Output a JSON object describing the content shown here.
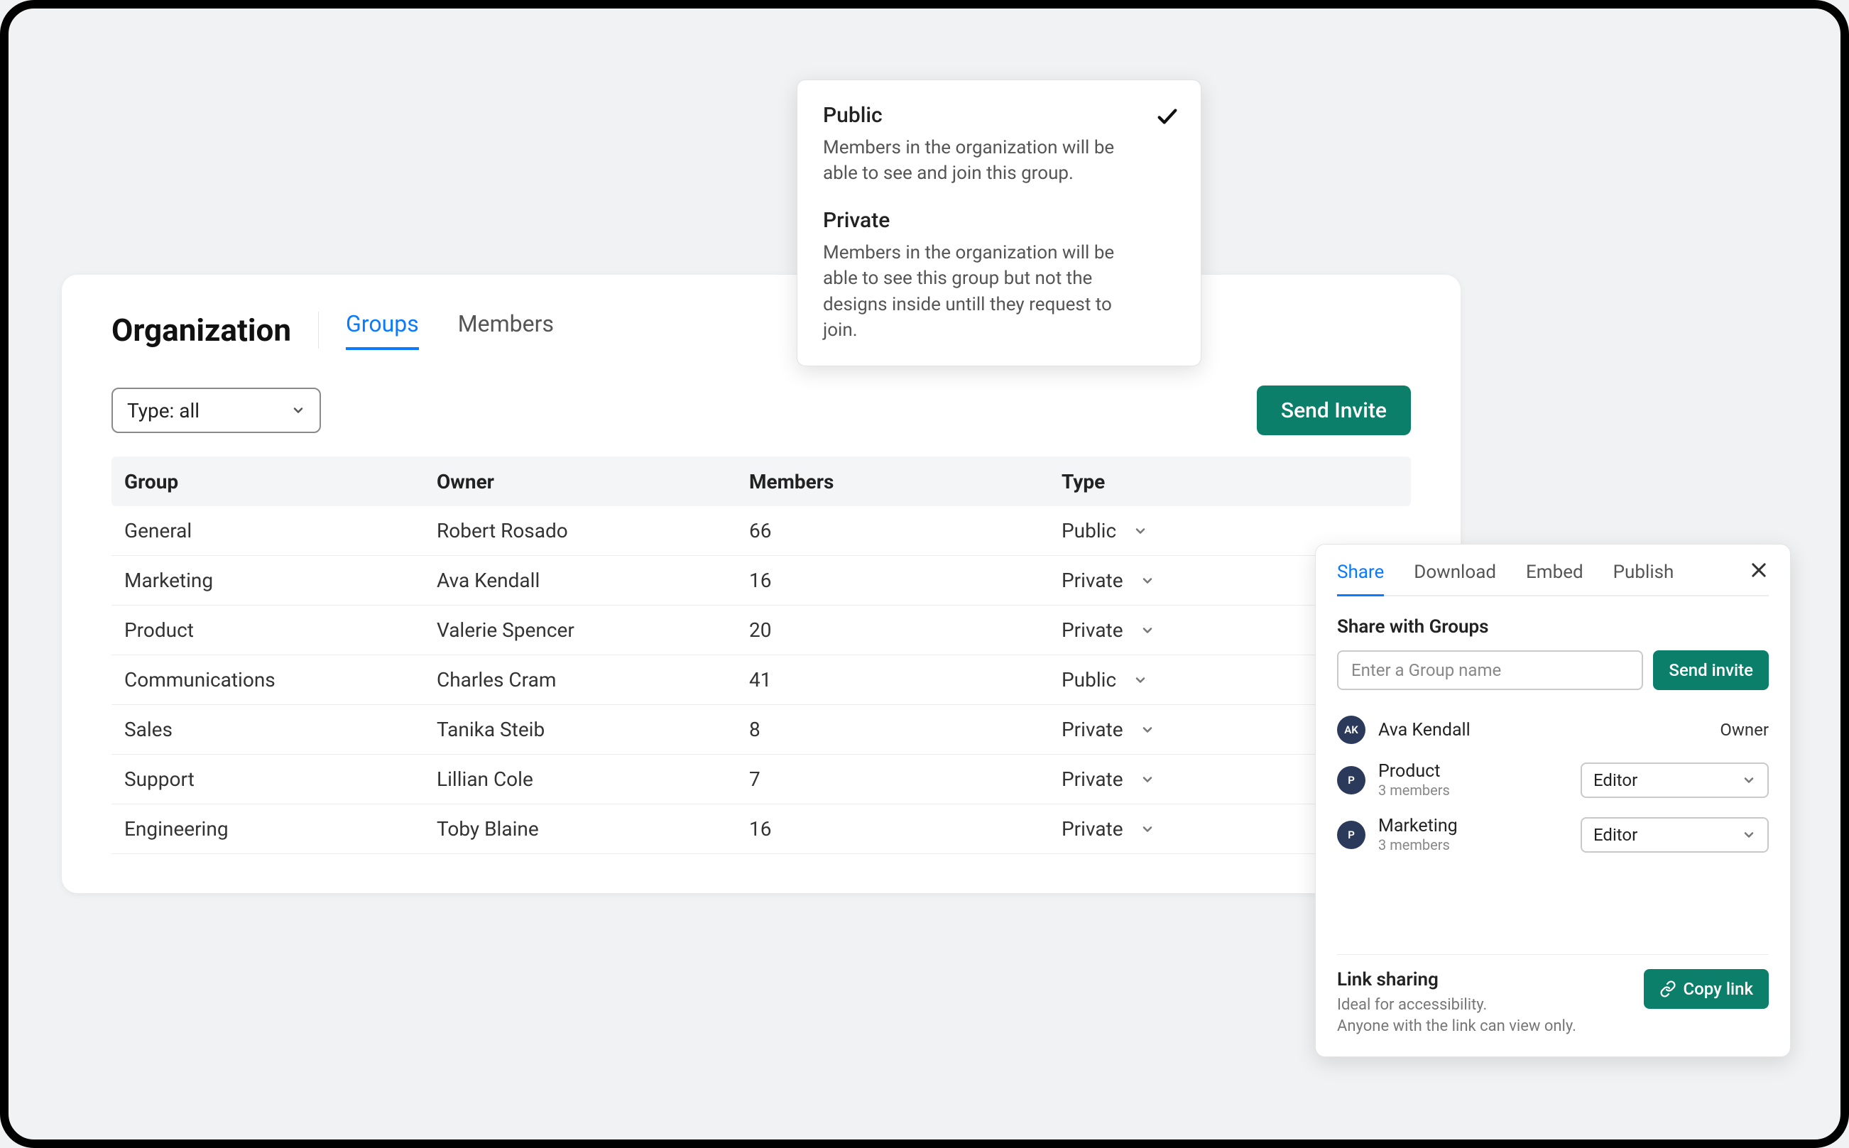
{
  "org": {
    "title": "Organization",
    "tabs": [
      {
        "label": "Groups",
        "active": true
      },
      {
        "label": "Members",
        "active": false
      }
    ],
    "filter_label": "Type: all",
    "send_invite_label": "Send Invite",
    "columns": {
      "group": "Group",
      "owner": "Owner",
      "members": "Members",
      "type": "Type"
    },
    "rows": [
      {
        "group": "General",
        "owner": "Robert Rosado",
        "members": "66",
        "type": "Public"
      },
      {
        "group": "Marketing",
        "owner": "Ava Kendall",
        "members": "16",
        "type": "Private"
      },
      {
        "group": "Product",
        "owner": "Valerie Spencer",
        "members": "20",
        "type": "Private"
      },
      {
        "group": "Communications",
        "owner": "Charles Cram",
        "members": "41",
        "type": "Public"
      },
      {
        "group": "Sales",
        "owner": "Tanika Steib",
        "members": "8",
        "type": "Private"
      },
      {
        "group": "Support",
        "owner": "Lillian Cole",
        "members": "7",
        "type": "Private"
      },
      {
        "group": "Engineering",
        "owner": "Toby Blaine",
        "members": "16",
        "type": "Private"
      }
    ]
  },
  "visibility_popover": {
    "options": [
      {
        "title": "Public",
        "desc": "Members in the organization will be able to see and join this group.",
        "selected": true
      },
      {
        "title": "Private",
        "desc": "Members in the organization will be able to see this group but not the designs inside untill they request to join.",
        "selected": false
      }
    ]
  },
  "share": {
    "tabs": [
      {
        "label": "Share",
        "active": true
      },
      {
        "label": "Download",
        "active": false
      },
      {
        "label": "Embed",
        "active": false
      },
      {
        "label": "Publish",
        "active": false
      }
    ],
    "section_title": "Share with Groups",
    "input_placeholder": "Enter a Group name",
    "send_invite_label": "Send invite",
    "entries": [
      {
        "type": "user",
        "initials": "AK",
        "name": "Ava Kendall",
        "sub": "",
        "role_type": "label",
        "role": "Owner"
      },
      {
        "type": "group",
        "initials": "P",
        "name": "Product",
        "sub": "3 members",
        "role_type": "select",
        "role": "Editor"
      },
      {
        "type": "group",
        "initials": "P",
        "name": "Marketing",
        "sub": "3 members",
        "role_type": "select",
        "role": "Editor"
      }
    ],
    "link": {
      "title": "Link sharing",
      "desc1": "Ideal for accessibility.",
      "desc2": "Anyone with the link can view only.",
      "button": "Copy link"
    }
  }
}
